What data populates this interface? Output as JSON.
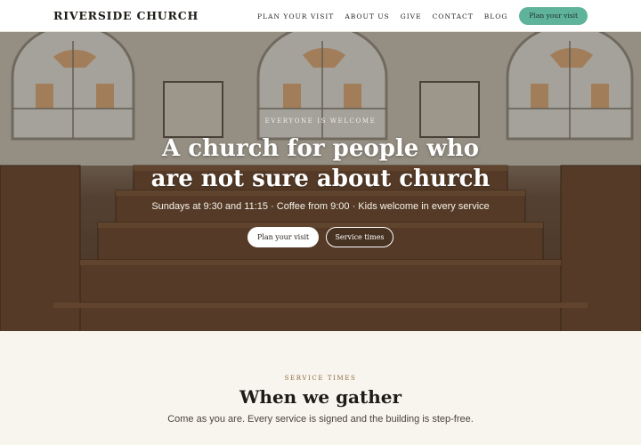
{
  "header": {
    "brand": "RIVERSIDE CHURCH",
    "nav": [
      "PLAN YOUR VISIT",
      "ABOUT US",
      "GIVE",
      "CONTACT",
      "BLOG"
    ],
    "cta": "Plan your visit"
  },
  "hero": {
    "eyebrow": "EVERYONE IS WELCOME",
    "title": "A church for people who are not sure about church",
    "subtitle": "Sundays at 9:30 and 11:15 · Coffee from 9:00 · Kids welcome in every service",
    "primary_button": "Plan your visit",
    "secondary_button": "Service times"
  },
  "services": {
    "eyebrow": "SERVICE TIMES",
    "title": "When we gather",
    "subtitle": "Come as you are. Every service is signed and the building is step-free."
  },
  "colors": {
    "accent": "#5fb39a",
    "eyebrow_gold": "#8a6a3d",
    "section_bg": "#f8f5ef"
  }
}
